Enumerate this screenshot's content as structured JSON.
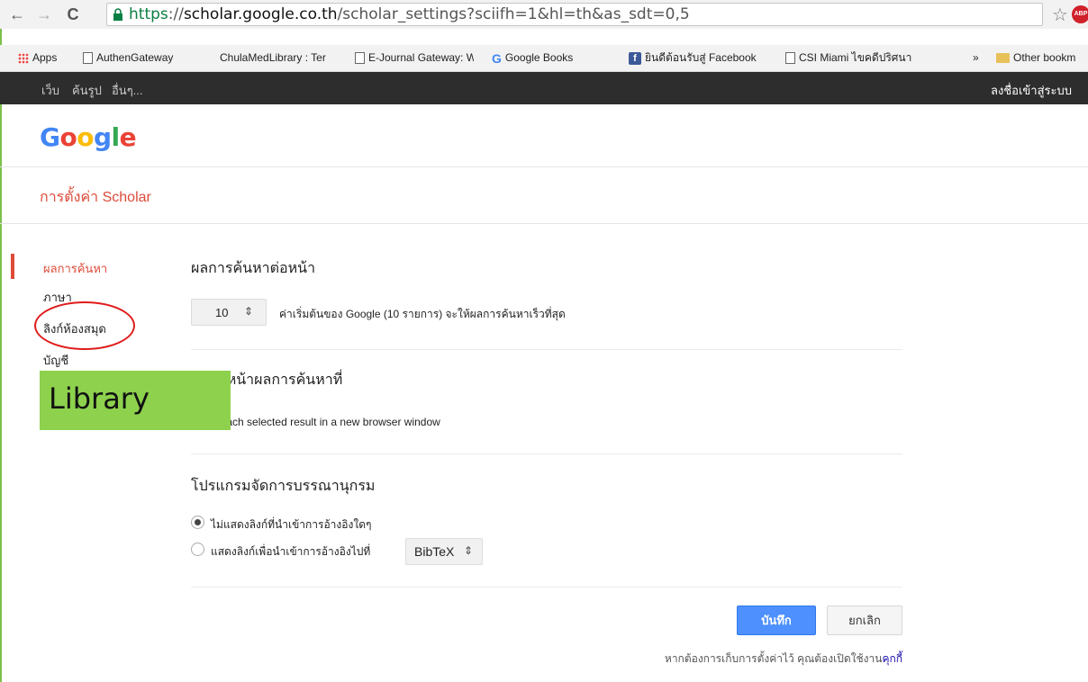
{
  "browser": {
    "url_scheme": "https",
    "url_separator": "://",
    "url_host": "scholar.google.co.th",
    "url_path": "/scholar_settings?sciifh=1&hl=th&as_sdt=0,5",
    "abp_label": "ABP"
  },
  "bookmarks": {
    "items": [
      "Apps",
      "AuthenGateway",
      "ChulaMedLibrary : Ter",
      "E-Journal Gateway: W",
      "Google Books",
      "ยินดีต้อนรับสู่ Facebook",
      "CSI Miami ไขคดีปริศนา"
    ],
    "more": "»",
    "other": "Other bookm"
  },
  "gbar": {
    "items": [
      "เว็บ",
      "ค้นรูป",
      "อื่นๆ..."
    ],
    "signin": "ลงชื่อเข้าสู่ระบบ"
  },
  "header": {
    "logo": [
      "G",
      "o",
      "o",
      "g",
      "l",
      "e"
    ],
    "logo_colors": [
      "#4285f4",
      "#ea4335",
      "#fbbc05",
      "#4285f4",
      "#34a853",
      "#ea4335"
    ],
    "settings_title": "การตั้งค่า Scholar"
  },
  "sidebar": {
    "items": [
      "ผลการค้นหา",
      "ภาษา",
      "ลิงก์ห้องสมุด",
      "บัญชี"
    ],
    "active_color": "#dd4b39"
  },
  "annotation": {
    "library_label": "Library"
  },
  "main": {
    "results_per_page": {
      "title": "ผลการค้นหาต่อหน้า",
      "value": "10",
      "description": "ค่าเริ่มต้นของ Google (10 รายการ) จะให้ผลการค้นหาเร็วที่สุด"
    },
    "open_results": {
      "title": "ผู้ด้านหน้าผลการค้นหาที่",
      "option": "Open each selected result in a new browser window"
    },
    "bibliography": {
      "title": "โปรแกรมจัดการบรรณานุกรม",
      "option_none": "ไม่แสดงลิงก์ที่นำเข้าการอ้างอิงใดๆ",
      "option_show": "แสดงลิงก์เพื่อนำเข้าการอ้างอิงไปที่",
      "format": "BibTeX"
    },
    "save_label": "บันทึก",
    "cancel_label": "ยกเลิก",
    "cookie_note": "หากต้องการเก็บการตั้งค่าไว้ คุณต้องเปิดใช้งาน",
    "cookie_link": "คุกกี้"
  }
}
